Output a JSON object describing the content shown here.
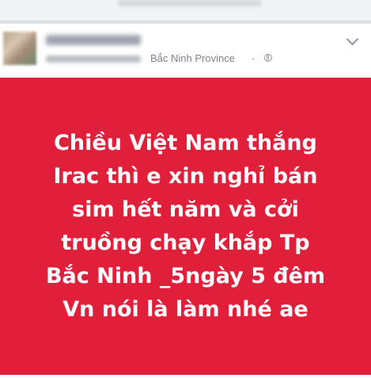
{
  "post": {
    "location": "Bắc Ninh Province",
    "separator": "·",
    "privacy_icon": "globe-icon",
    "menu_icon": "chevron-down-icon",
    "banner": {
      "background_color": "#e0203a",
      "text_color": "#ffffff",
      "lines": [
        "Chiều Việt Nam thắng",
        "Irac thì e xin nghỉ bán",
        "sim hết năm và cởi",
        "truồng chạy khắp Tp",
        "Bắc Ninh _5ngày 5 đêm",
        "Vn nói là làm nhé ae"
      ]
    }
  }
}
